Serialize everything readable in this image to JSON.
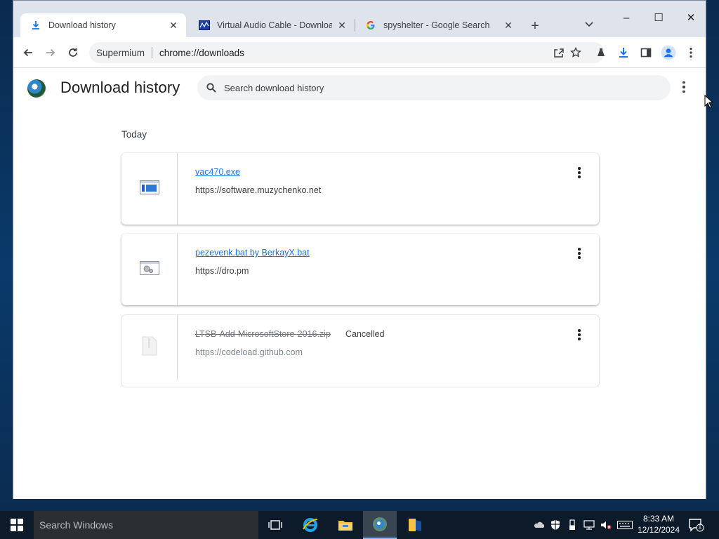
{
  "browser": {
    "tabs": [
      {
        "label": "Download history",
        "icon": "download-icon",
        "active": true
      },
      {
        "label": "Virtual Audio Cable - Download",
        "icon": "site-favicon",
        "active": false
      },
      {
        "label": "spyshelter - Google Search",
        "icon": "google-icon",
        "active": false
      }
    ],
    "omnibox": {
      "origin": "Supermium",
      "url": "chrome://downloads"
    },
    "window_controls": {
      "minimize": "–",
      "maximize": "☐",
      "close": "✕"
    }
  },
  "page": {
    "title": "Download history",
    "search_placeholder": "Search download history",
    "section_label": "Today",
    "downloads": [
      {
        "filename": "vac470.exe",
        "source": "https://software.muzychenko.net",
        "status": "",
        "icon": "exe-file-icon"
      },
      {
        "filename": "pezevenk.bat by BerkayX.bat",
        "source": "https://dro.pm",
        "status": "",
        "icon": "bat-file-icon"
      },
      {
        "filename": "LTSB-Add-MicrosoftStore-2016.zip",
        "source": "https://codeload.github.com",
        "status": "Cancelled",
        "icon": "zip-file-icon"
      }
    ]
  },
  "taskbar": {
    "search_placeholder": "Search Windows",
    "time": "8:33 AM",
    "date": "12/12/2024",
    "notification_count": "1"
  },
  "colors": {
    "link": "#1a73e8",
    "tabstrip": "#dfe3eb",
    "taskbar": "#0d1a2a"
  }
}
